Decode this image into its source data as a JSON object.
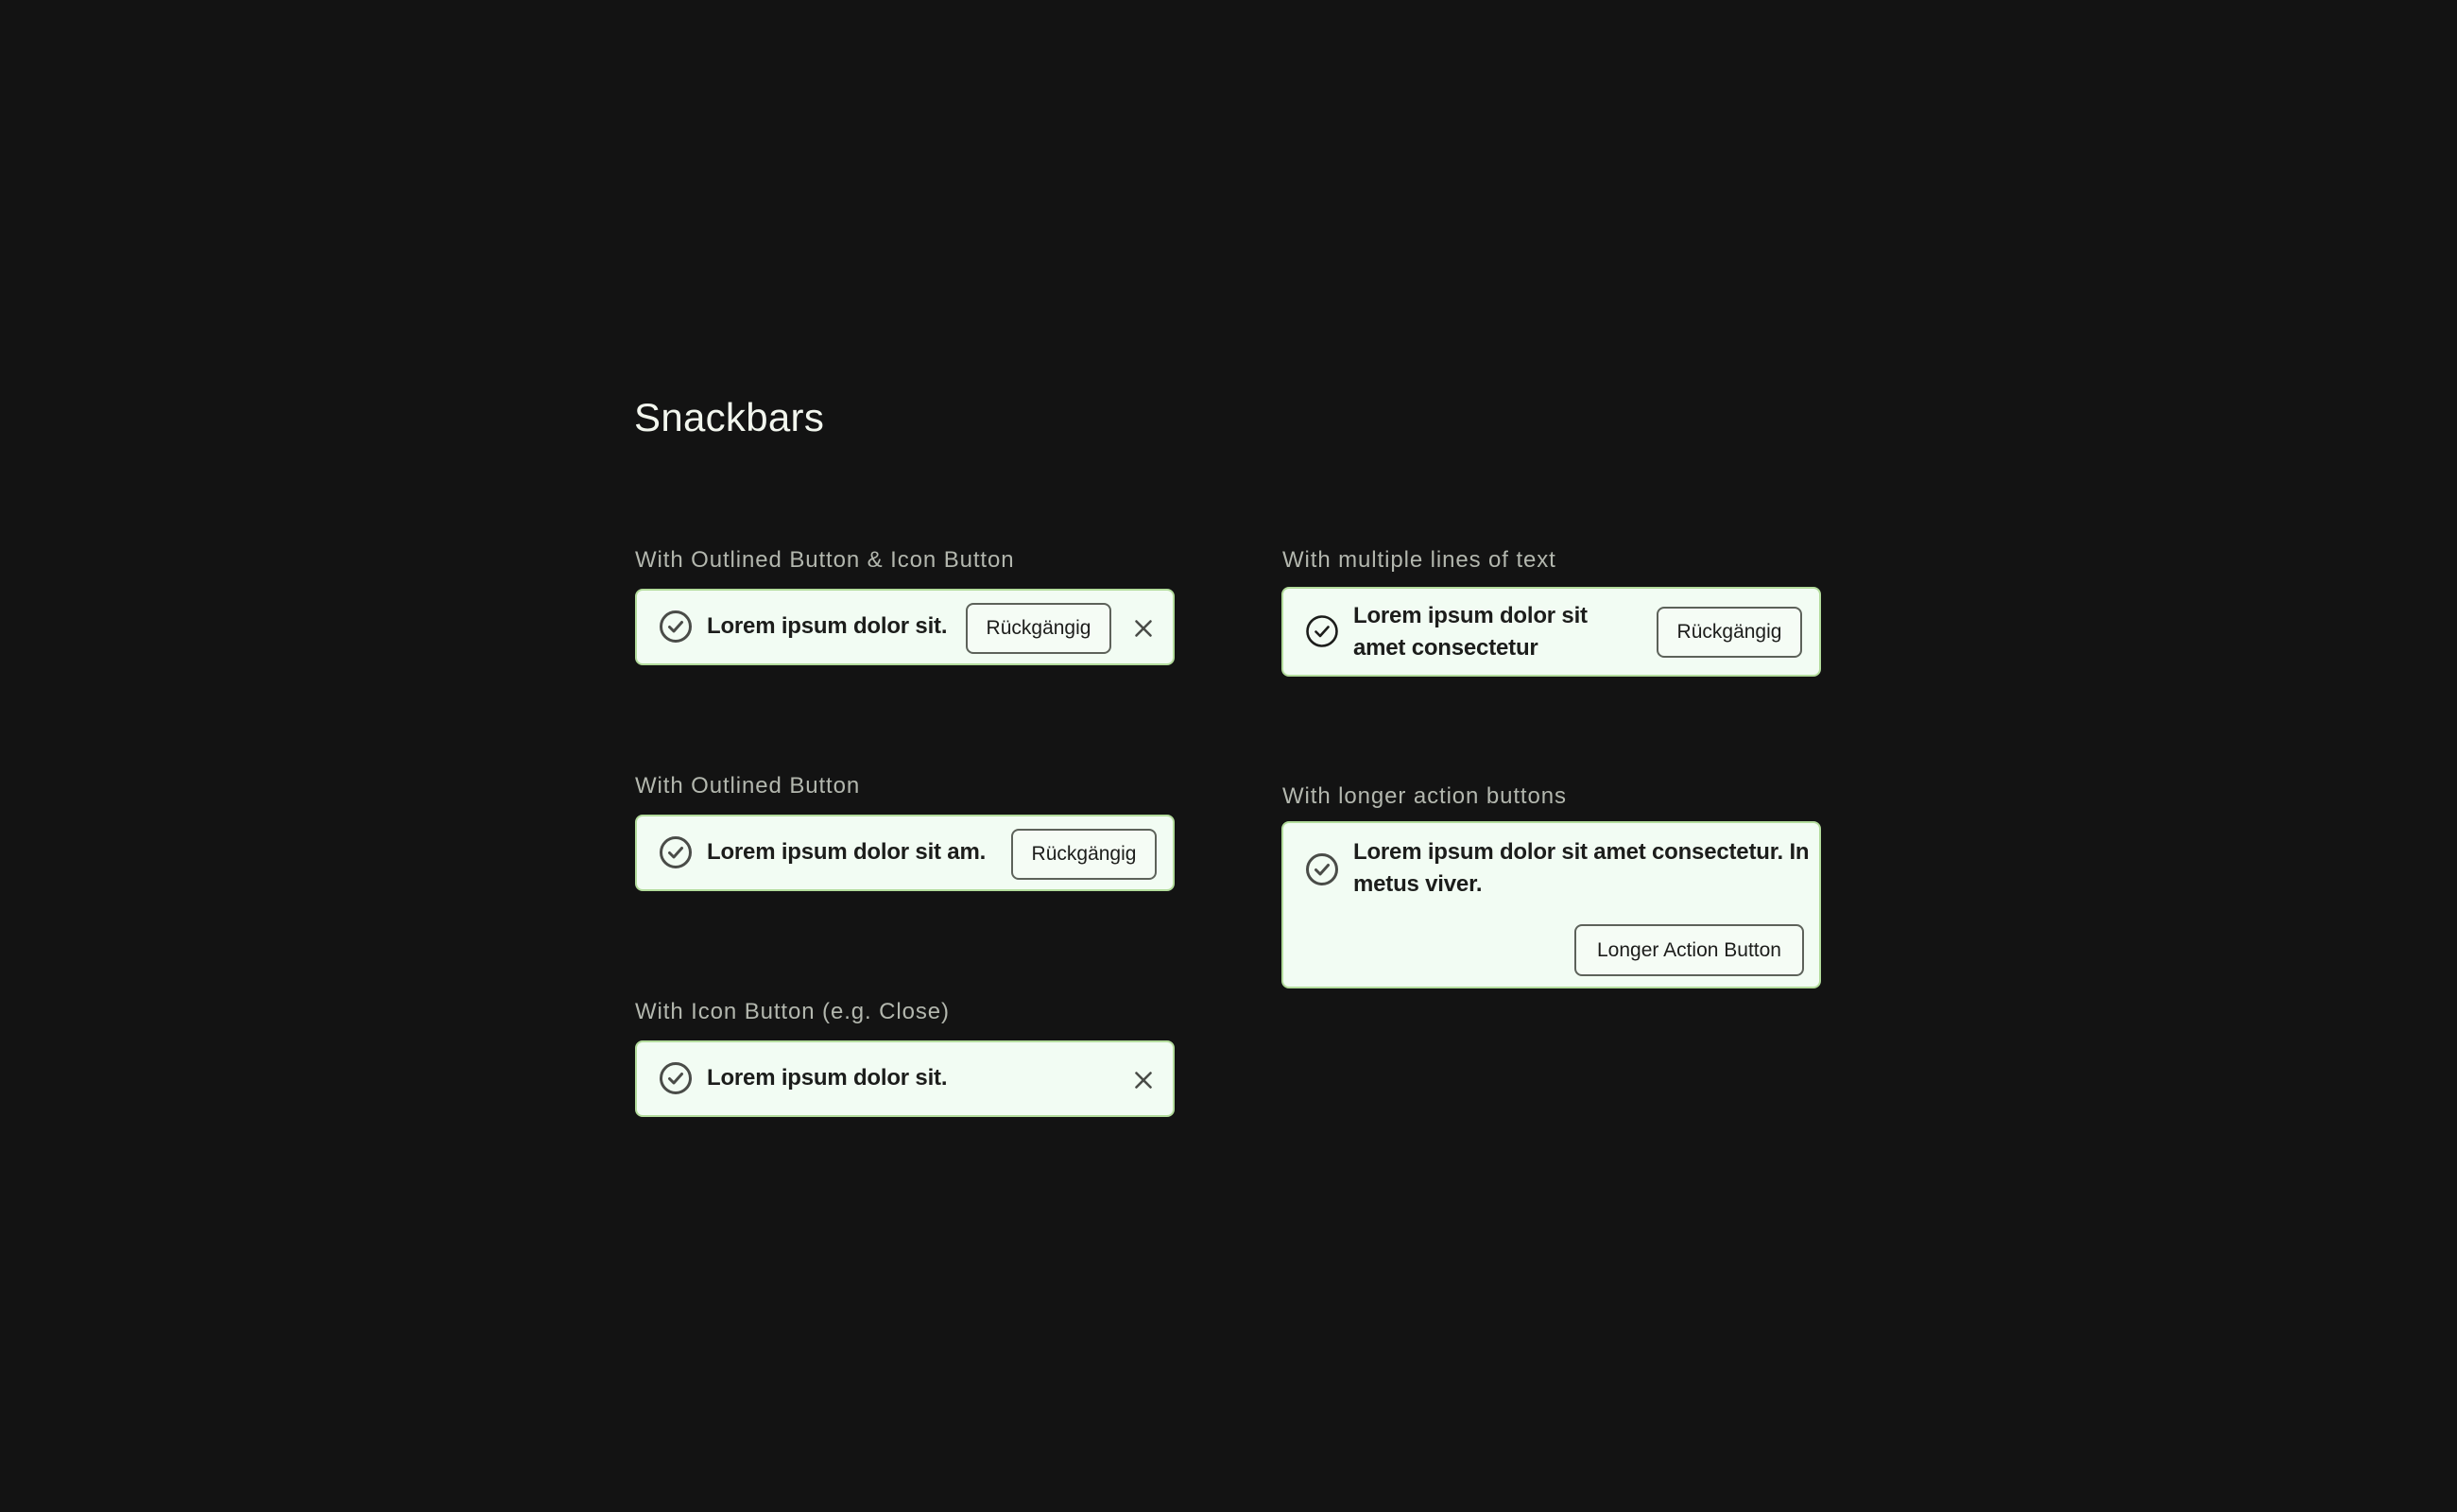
{
  "page": {
    "title": "Snackbars"
  },
  "snackbars": [
    {
      "label": "With Outlined Button & Icon Button",
      "message": "Lorem ipsum dolor sit.",
      "action_label": "Rückgängig",
      "icon": "check-circle-icon",
      "close_icon": "close-icon"
    },
    {
      "label": "With Outlined Button",
      "message": "Lorem ipsum dolor sit am.",
      "action_label": "Rückgängig",
      "icon": "check-circle-icon"
    },
    {
      "label": "With Icon Button (e.g. Close)",
      "message": "Lorem ipsum dolor sit.",
      "icon": "check-circle-icon",
      "close_icon": "close-icon"
    },
    {
      "label": "With multiple lines of text",
      "message_lines": [
        "Lorem ipsum dolor sit",
        "amet consectetur"
      ],
      "action_label": "Rückgängig",
      "icon": "check-circle-icon"
    },
    {
      "label": "With longer action buttons",
      "message_lines": [
        "Lorem ipsum dolor sit amet consectetur. In",
        "metus viver."
      ],
      "action_label": "Longer Action Button",
      "icon": "check-circle-icon"
    }
  ],
  "colors": {
    "background": "#131313",
    "snackbar_background": "#f2fcf3",
    "snackbar_border": "#b3dc9c",
    "text": "#1c1d1b",
    "icon": "#4a4c48",
    "label": "#b3b7ae"
  }
}
